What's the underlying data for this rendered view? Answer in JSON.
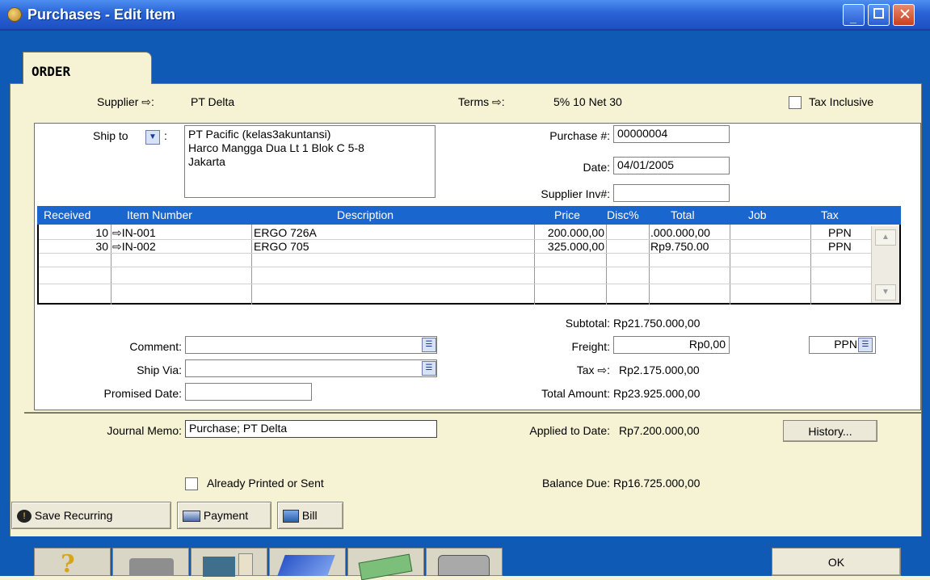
{
  "window": {
    "title": "Purchases - Edit Item",
    "tab": "ORDER"
  },
  "header": {
    "supplier_label": "Supplier ⇨:",
    "supplier_value": "PT Delta",
    "terms_label": "Terms ⇨:",
    "terms_value": "5% 10 Net 30",
    "tax_inclusive_label": "Tax Inclusive"
  },
  "shipto": {
    "label": "Ship to",
    "colon": ":",
    "line1": "PT Pacific (kelas3akuntansi)",
    "line2": "Harco Mangga Dua Lt 1 Blok C 5-8",
    "line3": "Jakarta"
  },
  "purchase": {
    "purchase_label": "Purchase #:",
    "purchase_value": "00000004",
    "date_label": "Date:",
    "date_value": "04/01/2005",
    "supplier_inv_label": "Supplier Inv#:",
    "supplier_inv_value": ""
  },
  "grid": {
    "headers": {
      "received": "Received",
      "item": "Item Number",
      "description": "Description",
      "price": "Price",
      "disc": "Disc%",
      "total": "Total",
      "job": "Job",
      "tax": "Tax"
    },
    "rows": [
      {
        "received": "10",
        "item": "⇨IN-001",
        "description": "ERGO 726A",
        "price": "200.000,00",
        "disc": "",
        "total": ".000.000,00",
        "job": "",
        "tax": "PPN"
      },
      {
        "received": "30",
        "item": "⇨IN-002",
        "description": "ERGO 705",
        "price": "325.000,00",
        "disc": "",
        "total": "Rp9.750.00",
        "job": "",
        "tax": "PPN"
      }
    ]
  },
  "totals": {
    "subtotal_label": "Subtotal:",
    "subtotal_value": "Rp21.750.000,00",
    "freight_label": "Freight:",
    "freight_value": "Rp0,00",
    "freight_tax": "PPN",
    "tax_label": "Tax ⇨:",
    "tax_value": "Rp2.175.000,00",
    "total_label": "Total Amount:",
    "total_value": "Rp23.925.000,00"
  },
  "details": {
    "comment_label": "Comment:",
    "comment_value": "",
    "shipvia_label": "Ship Via:",
    "shipvia_value": "",
    "promised_label": "Promised Date:",
    "promised_value": ""
  },
  "footer": {
    "memo_label": "Journal Memo:",
    "memo_value": "Purchase; PT Delta",
    "applied_label": "Applied to Date:",
    "applied_value": "Rp7.200.000,00",
    "history_button": "History...",
    "printed_label": "Already Printed or Sent",
    "balance_label": "Balance Due:",
    "balance_value": "Rp16.725.000,00"
  },
  "toolbar": {
    "save_recurring": "Save Recurring",
    "payment": "Payment",
    "bill": "Bill",
    "ok": "OK"
  },
  "icons": [
    "help-icon",
    "printer-icon",
    "mail-icon",
    "book-icon",
    "money-icon",
    "register-icon"
  ]
}
